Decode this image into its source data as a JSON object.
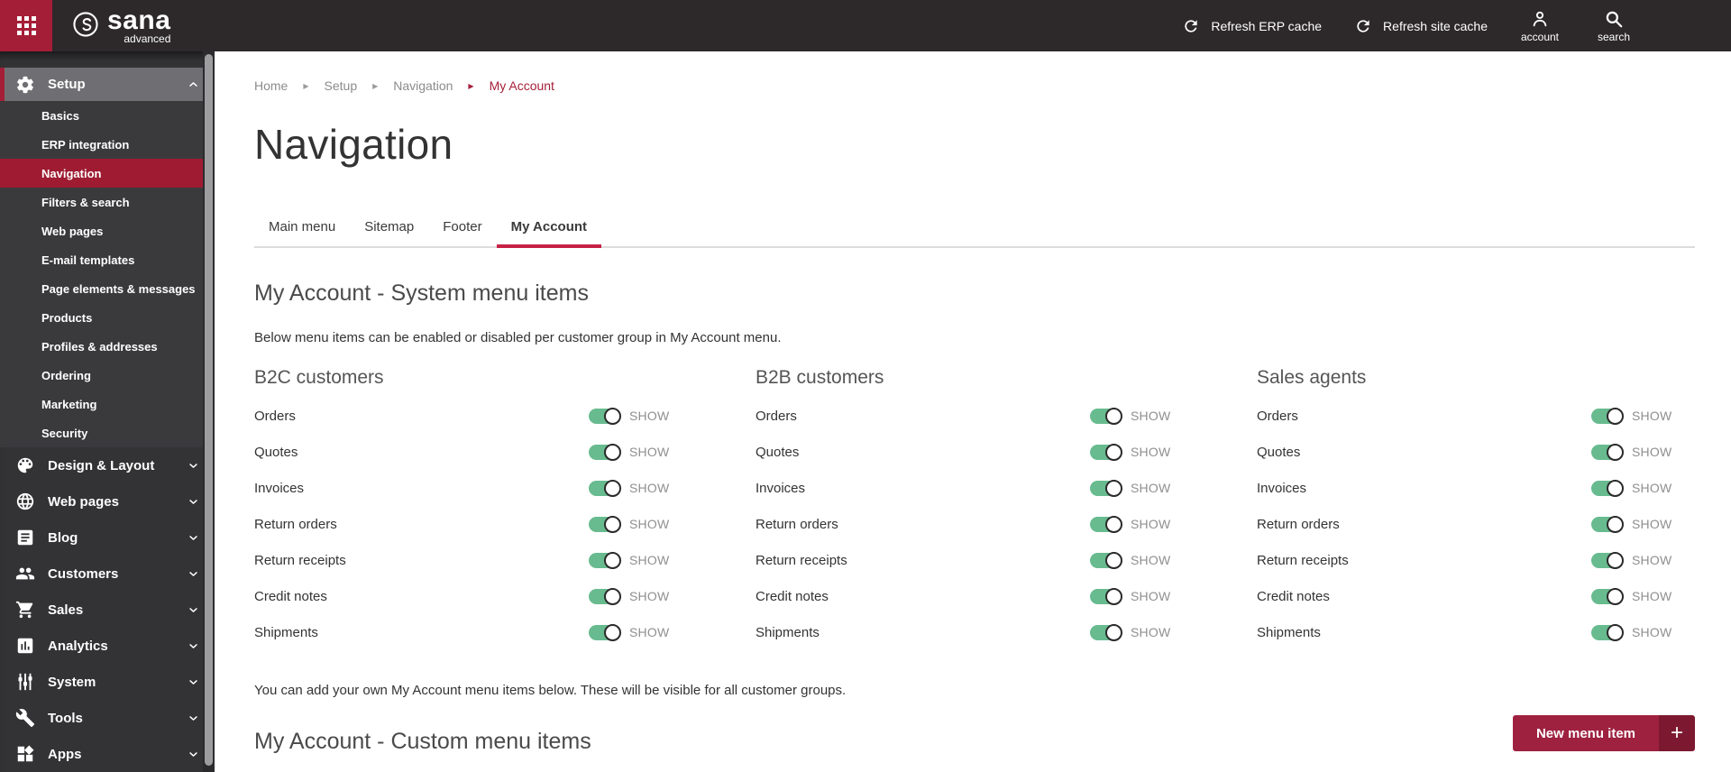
{
  "topbar": {
    "brand": {
      "name": "sana",
      "tagline": "advanced"
    },
    "refresh_erp": "Refresh ERP cache",
    "refresh_site": "Refresh site cache",
    "account_label": "account",
    "search_label": "search"
  },
  "sidebar": {
    "sections": [
      {
        "label": "Setup",
        "icon": "gear-icon",
        "state": "expanded",
        "active_item": "Navigation",
        "items": [
          "Basics",
          "ERP integration",
          "Navigation",
          "Filters & search",
          "Web pages",
          "E-mail templates",
          "Page elements & messages",
          "Products",
          "Profiles & addresses",
          "Ordering",
          "Marketing",
          "Security"
        ]
      },
      {
        "label": "Design & Layout",
        "icon": "palette-icon",
        "state": "collapsed"
      },
      {
        "label": "Web pages",
        "icon": "globe-icon",
        "state": "collapsed"
      },
      {
        "label": "Blog",
        "icon": "blog-icon",
        "state": "collapsed"
      },
      {
        "label": "Customers",
        "icon": "customers-icon",
        "state": "collapsed"
      },
      {
        "label": "Sales",
        "icon": "cart-icon",
        "state": "collapsed"
      },
      {
        "label": "Analytics",
        "icon": "analytics-icon",
        "state": "collapsed"
      },
      {
        "label": "System",
        "icon": "sliders-icon",
        "state": "collapsed"
      },
      {
        "label": "Tools",
        "icon": "wrench-icon",
        "state": "collapsed"
      },
      {
        "label": "Apps",
        "icon": "apps-icon",
        "state": "collapsed"
      }
    ]
  },
  "breadcrumb": [
    "Home",
    "Setup",
    "Navigation",
    "My Account"
  ],
  "page_title": "Navigation",
  "tabs": {
    "items": [
      "Main menu",
      "Sitemap",
      "Footer",
      "My Account"
    ],
    "active": "My Account"
  },
  "system_menu": {
    "heading": "My Account - System menu items",
    "description": "Below menu items can be enabled or disabled per customer group in My Account menu.",
    "groups": [
      "B2C customers",
      "B2B customers",
      "Sales agents"
    ],
    "items": [
      "Orders",
      "Quotes",
      "Invoices",
      "Return orders",
      "Return receipts",
      "Credit notes",
      "Shipments"
    ],
    "toggle_label": "SHOW",
    "toggle_on": true
  },
  "custom_menu": {
    "note": "You can add your own My Account menu items below. These will be visible for all customer groups.",
    "heading": "My Account - Custom menu items",
    "new_button": "New menu item"
  },
  "colors": {
    "accent": "#9e2140",
    "app_button": "#a51e37",
    "sidebar_active": "#9e1b32",
    "tab_underline": "#c62245",
    "toggle_on": "#68bb8f",
    "breadcrumb_active": "#a6203a",
    "new_button_plus_bg": "#7c1930"
  }
}
